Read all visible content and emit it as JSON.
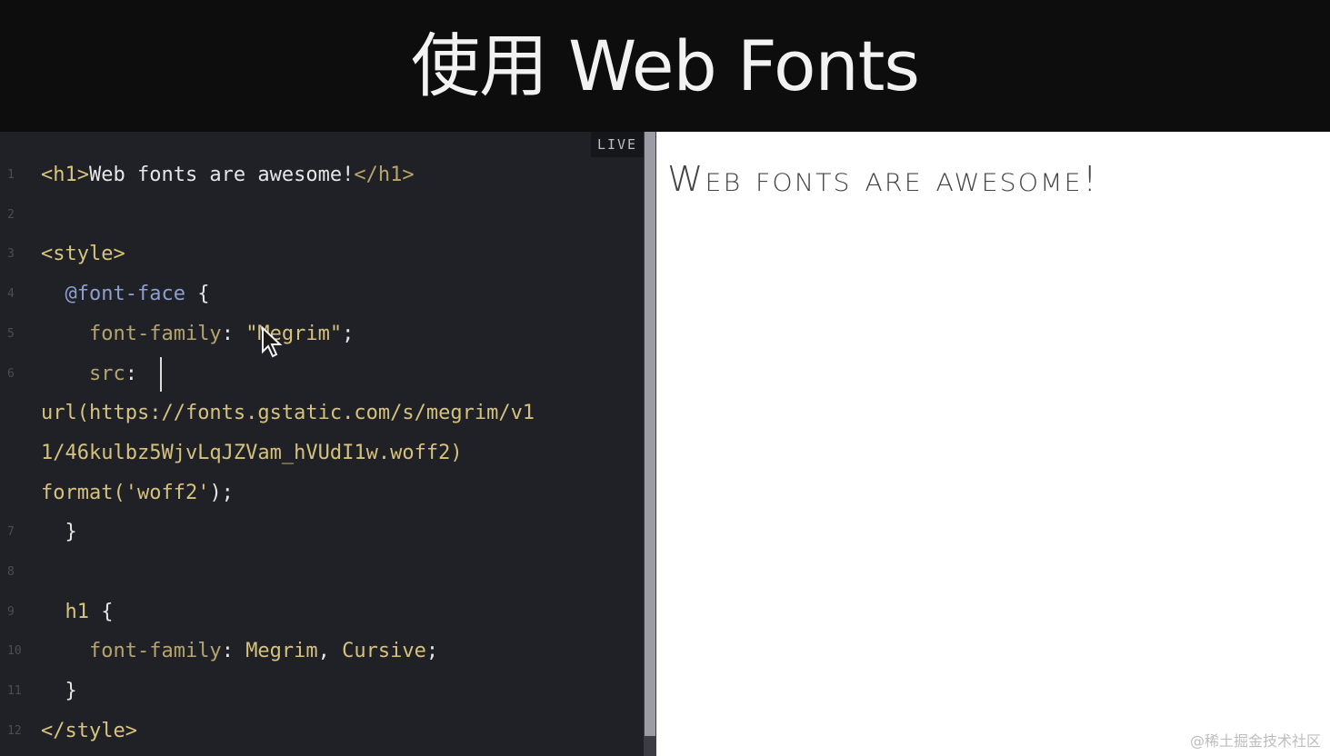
{
  "title": "使用 Web Fonts",
  "editor": {
    "live_label": "LIVE",
    "lines": [
      {
        "num": "1",
        "parts": [
          [
            "<h1>",
            "tag"
          ],
          [
            "Web fonts are awesome!",
            "plain"
          ],
          [
            "</h1>",
            "closetag"
          ]
        ]
      },
      {
        "num": "2",
        "parts": []
      },
      {
        "num": "3",
        "parts": [
          [
            "<style>",
            "tag"
          ]
        ]
      },
      {
        "num": "4",
        "parts": [
          [
            "  ",
            "plain"
          ],
          [
            "@font-face",
            "at"
          ],
          [
            " {",
            "plain"
          ]
        ]
      },
      {
        "num": "5",
        "parts": [
          [
            "    ",
            "plain"
          ],
          [
            "font-family",
            "prop"
          ],
          [
            ": ",
            "plain"
          ],
          [
            "\"Megrim\"",
            "str"
          ],
          [
            ";",
            "plain"
          ]
        ]
      },
      {
        "num": "6",
        "parts": [
          [
            "    ",
            "plain"
          ],
          [
            "src",
            "prop"
          ],
          [
            ":",
            "plain"
          ]
        ]
      },
      {
        "num": "",
        "parts": [
          [
            "url(",
            "fn"
          ],
          [
            "https://fonts.gstatic.com/s/megrim/v1",
            "str"
          ]
        ]
      },
      {
        "num": "",
        "parts": [
          [
            "1/46kulbz5WjvLqJZVam_hVUdI1w.woff2",
            "str"
          ],
          [
            ")",
            "fn"
          ]
        ]
      },
      {
        "num": "",
        "parts": [
          [
            "format(",
            "fn"
          ],
          [
            "'woff2'",
            "str"
          ],
          [
            ");",
            "plain"
          ]
        ]
      },
      {
        "num": "7",
        "parts": [
          [
            "  }",
            "plain"
          ]
        ]
      },
      {
        "num": "8",
        "parts": []
      },
      {
        "num": "9",
        "parts": [
          [
            "  ",
            "plain"
          ],
          [
            "h1",
            "tag"
          ],
          [
            " {",
            "plain"
          ]
        ]
      },
      {
        "num": "10",
        "parts": [
          [
            "    ",
            "plain"
          ],
          [
            "font-family",
            "prop"
          ],
          [
            ": ",
            "plain"
          ],
          [
            "Megrim",
            "str"
          ],
          [
            ", ",
            "plain"
          ],
          [
            "Cursive",
            "str"
          ],
          [
            ";",
            "plain"
          ]
        ]
      },
      {
        "num": "11",
        "parts": [
          [
            "  }",
            "plain"
          ]
        ]
      },
      {
        "num": "12",
        "parts": [
          [
            "</style>",
            "tag"
          ]
        ]
      }
    ]
  },
  "preview": {
    "heading": "Web fonts are awesome!"
  },
  "watermark": "@稀土掘金技术社区",
  "icons": {
    "cursor": "mouse-pointer-icon"
  }
}
